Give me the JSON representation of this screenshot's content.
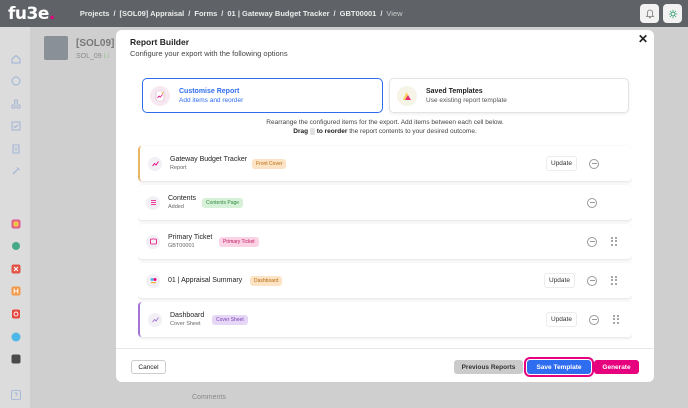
{
  "app": {
    "logo_text": "fu3e",
    "logo_dot": "."
  },
  "breadcrumb": [
    {
      "label": "Projects"
    },
    {
      "label": "[SOL09] Appraisal"
    },
    {
      "label": "Forms"
    },
    {
      "label": "01 | Gateway Budget Tracker"
    },
    {
      "label": "GBT00001"
    },
    {
      "label": "View"
    }
  ],
  "breadcrumb_sep": "/",
  "background": {
    "title": "[SOL09]",
    "subtitle": "SOL_09",
    "status": "Li",
    "comments": "Comments"
  },
  "modal": {
    "title": "Report Builder",
    "subtitle": "Configure your export with the following options",
    "close": "✕",
    "options": [
      {
        "title": "Customise Report",
        "desc": "Add items and reorder"
      },
      {
        "title": "Saved Templates",
        "desc": "Use existing report template"
      }
    ],
    "instruction_line1": "Rearrange the configured items for the export. Add items between each cell below.",
    "instruction_drag": "Drag",
    "instruction_bold2": "to reorder",
    "instruction_rest": "the report contents to your desired outcome.",
    "items": [
      {
        "name": "Gateway Budget Tracker",
        "sub": "Report",
        "badge": "Front Cover",
        "badge_color": "#fbe3c3",
        "badge_text": "#b86a12",
        "update": "Update"
      },
      {
        "name": "Contents",
        "sub": "Added",
        "badge": "Contents Page",
        "badge_color": "#d7f1d9",
        "badge_text": "#2e8b3f",
        "update": ""
      },
      {
        "name": "Primary Ticket",
        "sub": "GBT00001",
        "badge": "Primary Ticket",
        "badge_color": "#fbd3e6",
        "badge_text": "#c2185b",
        "update": ""
      },
      {
        "name": "01 | Appraisal Summary",
        "sub": "",
        "badge": "Dashboard",
        "badge_color": "#fbe3c3",
        "badge_text": "#b86a12",
        "update": "Update"
      },
      {
        "name": "Dashboard",
        "sub": "Cover Sheet",
        "badge": "Cover Sheet",
        "badge_color": "#e7d7f6",
        "badge_text": "#7a3fb8",
        "update": "Update"
      }
    ],
    "buttons": {
      "cancel": "Cancel",
      "previous": "Previous Reports",
      "save": "Save Template",
      "generate": "Generate"
    }
  },
  "colors": {
    "accent": "#2f6df0",
    "brand": "#e6007e"
  }
}
